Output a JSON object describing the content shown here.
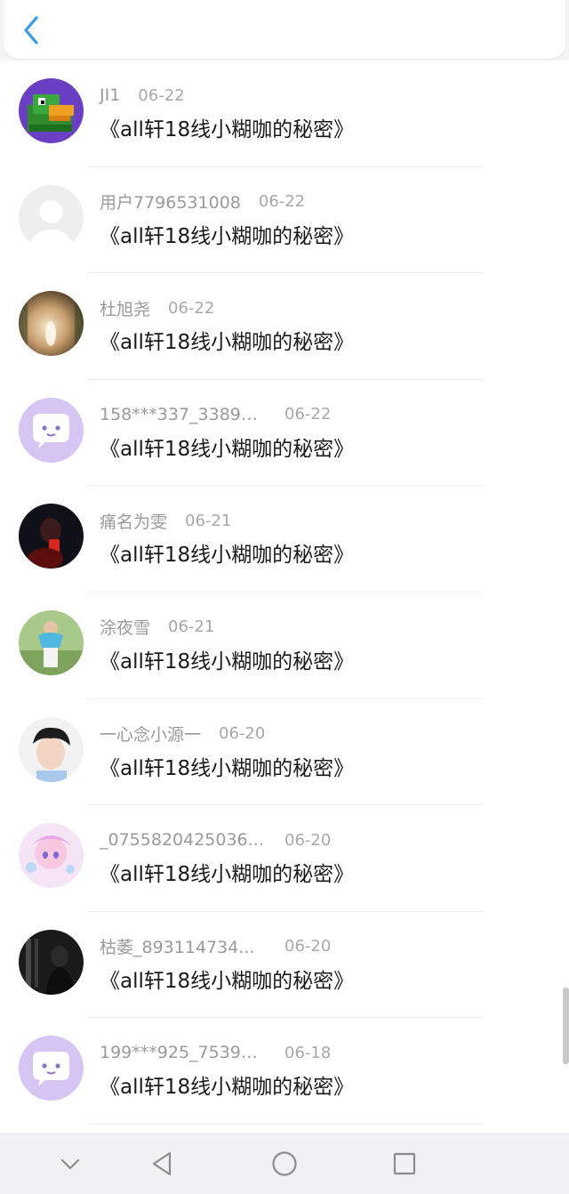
{
  "header": {
    "back_icon": "chevron-left-icon",
    "accent": "#3a9be8"
  },
  "comments": [
    {
      "name": "JI1",
      "date": "06-22",
      "title": "《all轩18线小糊咖的秘密》",
      "avatar": "duck-avatar"
    },
    {
      "name": "用户7796531008",
      "date": "06-22",
      "title": "《all轩18线小糊咖的秘密》",
      "avatar": "default-avatar"
    },
    {
      "name": "杜旭尧",
      "date": "06-22",
      "title": "《all轩18线小糊咖的秘密》",
      "avatar": "photo-avatar"
    },
    {
      "name": "158***337_33895...",
      "date": "06-22",
      "title": "《all轩18线小糊咖的秘密》",
      "avatar": "chat-bubble-avatar"
    },
    {
      "name": "痛名为雯",
      "date": "06-21",
      "title": "《all轩18线小糊咖的秘密》",
      "avatar": "photo-avatar"
    },
    {
      "name": "涂夜雪",
      "date": "06-21",
      "title": "《all轩18线小糊咖的秘密》",
      "avatar": "photo-avatar"
    },
    {
      "name": "一心念小源一",
      "date": "06-20",
      "title": "《all轩18线小糊咖的秘密》",
      "avatar": "photo-avatar"
    },
    {
      "name": "_0755820425036...",
      "date": "06-20",
      "title": "《all轩18线小糊咖的秘密》",
      "avatar": "anime-avatar"
    },
    {
      "name": "枯萎_893114734...",
      "date": "06-20",
      "title": "《all轩18线小糊咖的秘密》",
      "avatar": "photo-avatar"
    },
    {
      "name": "199***925_75393...",
      "date": "06-18",
      "title": "《all轩18线小糊咖的秘密》",
      "avatar": "chat-bubble-avatar"
    }
  ],
  "navigation": {
    "icons": [
      "chevron-down-icon",
      "back-triangle-icon",
      "home-circle-icon",
      "recents-square-icon"
    ]
  }
}
